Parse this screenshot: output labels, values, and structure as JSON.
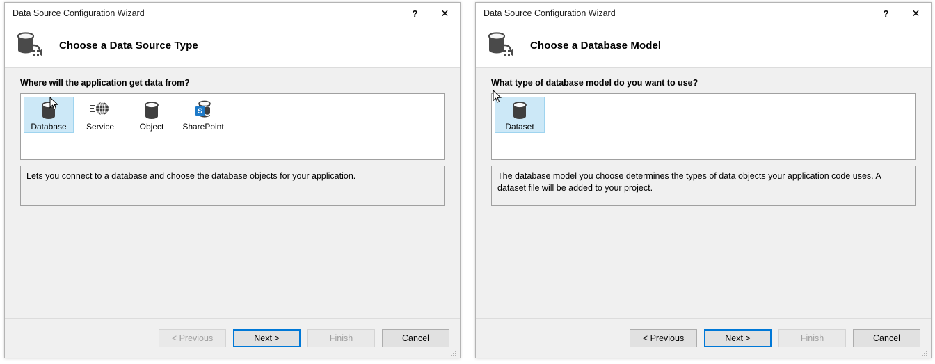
{
  "dialogs": [
    {
      "id": "data-source-type",
      "titlebar": {
        "title": "Data Source Configuration Wizard",
        "help_label": "?",
        "close_label": "✕"
      },
      "header": {
        "icon": "database-connection-icon",
        "title": "Choose a Data Source Type"
      },
      "prompt": "Where will the application get data from?",
      "tiles": [
        {
          "label": "Database",
          "icon": "database-icon",
          "selected": true
        },
        {
          "label": "Service",
          "icon": "service-icon",
          "selected": false
        },
        {
          "label": "Object",
          "icon": "object-icon",
          "selected": false
        },
        {
          "label": "SharePoint",
          "icon": "sharepoint-icon",
          "selected": false
        }
      ],
      "description": "Lets you connect to a database and choose the database objects for your application.",
      "buttons": [
        {
          "label": "< Previous",
          "state": "disabled"
        },
        {
          "label": "Next >",
          "state": "default"
        },
        {
          "label": "Finish",
          "state": "disabled"
        },
        {
          "label": "Cancel",
          "state": "normal"
        }
      ]
    },
    {
      "id": "database-model",
      "titlebar": {
        "title": "Data Source Configuration Wizard",
        "help_label": "?",
        "close_label": "✕"
      },
      "header": {
        "icon": "database-connection-icon",
        "title": "Choose a Database Model"
      },
      "prompt": "What type of database model do you want to use?",
      "tiles": [
        {
          "label": "Dataset",
          "icon": "database-icon",
          "selected": true
        }
      ],
      "description": "The database model you choose determines the types of data objects your application code uses. A dataset file will be added to your project.",
      "buttons": [
        {
          "label": "< Previous",
          "state": "normal"
        },
        {
          "label": "Next >",
          "state": "default"
        },
        {
          "label": "Finish",
          "state": "disabled"
        },
        {
          "label": "Cancel",
          "state": "normal"
        }
      ]
    }
  ],
  "colors": {
    "accent": "#0078d7",
    "selection_fill": "#cce8f7",
    "selection_border": "#9fd4ef",
    "dialog_bg": "#f0f0f0",
    "panel_bg": "#ffffff",
    "icon_dark": "#3f3f3f",
    "sharepoint_blue": "#1e7ac8"
  }
}
